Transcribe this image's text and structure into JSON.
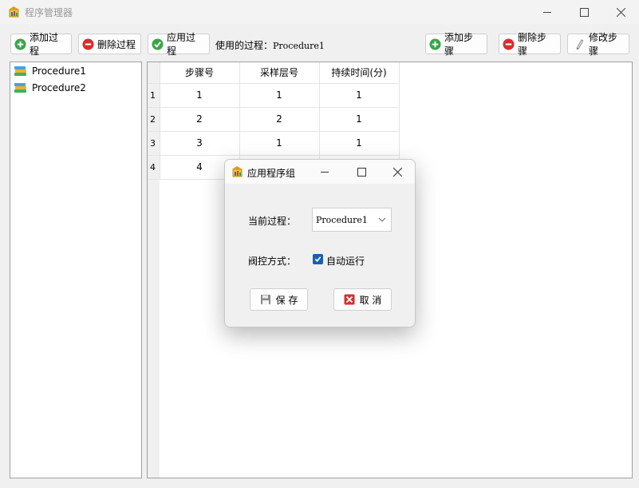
{
  "window": {
    "title": "程序管理器"
  },
  "toolbar": {
    "add_procedure": "添加过程",
    "delete_procedure": "删除过程",
    "apply_procedure": "应用过程",
    "used_label": "使用的过程：",
    "used_value": "Procedure1",
    "add_step": "添加步骤",
    "delete_step": "删除步骤",
    "edit_step": "修改步骤"
  },
  "tree": {
    "items": [
      "Procedure1",
      "Procedure2"
    ]
  },
  "grid": {
    "columns": [
      "步骤号",
      "采样层号",
      "持续时间(分)"
    ],
    "rows": [
      {
        "num": "1",
        "cells": [
          "1",
          "1",
          "1"
        ]
      },
      {
        "num": "2",
        "cells": [
          "2",
          "2",
          "1"
        ]
      },
      {
        "num": "3",
        "cells": [
          "3",
          "1",
          "1"
        ]
      },
      {
        "num": "4",
        "cells": [
          "4",
          "",
          ""
        ]
      }
    ]
  },
  "dialog": {
    "title": "应用程序组",
    "current_label": "当前过程：",
    "current_value": "Procedure1",
    "valve_label": "阀控方式：",
    "auto_run_label": "自动运行",
    "auto_run_checked": true,
    "save_label": "保 存",
    "cancel_label": "取 消"
  },
  "colors": {
    "add_green": "#3aa54a",
    "delete_red": "#d32f2f",
    "check_blue": "#1a5fb4"
  }
}
